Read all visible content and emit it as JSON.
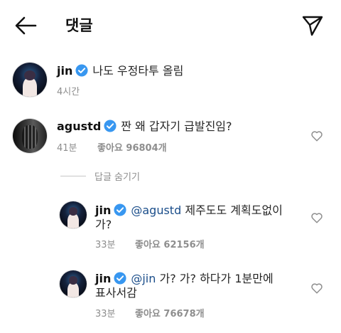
{
  "header": {
    "title": "댓글"
  },
  "caption": {
    "username": "jin",
    "text": "나도 우정타투 올림",
    "time": "4시간"
  },
  "comments": [
    {
      "username": "agustd",
      "text": "짠 왜 갑자기 급발진임?",
      "time": "41분",
      "likes": "좋아요 96804개"
    }
  ],
  "hide_replies_label": "답글 숨기기",
  "replies": [
    {
      "username": "jin",
      "mention": "@agustd",
      "text_line1": "제주도도 계획도없이",
      "text_line2": "가?",
      "time": "33분",
      "likes": "좋아요 62156개"
    },
    {
      "username": "jin",
      "mention": "@jin",
      "text_line1": "가? 가? 하다가 1분만에",
      "text_line2": "표사서감",
      "time": "33분",
      "likes": "좋아요 76678개"
    }
  ],
  "icons": {
    "back": "arrow-left-icon",
    "send": "paper-plane-icon",
    "verified": "verified-badge-icon",
    "like": "heart-outline-icon"
  },
  "colors": {
    "verified_badge": "#3897f0",
    "mention": "#1a4d8a",
    "meta_text": "#8e8e8e"
  }
}
